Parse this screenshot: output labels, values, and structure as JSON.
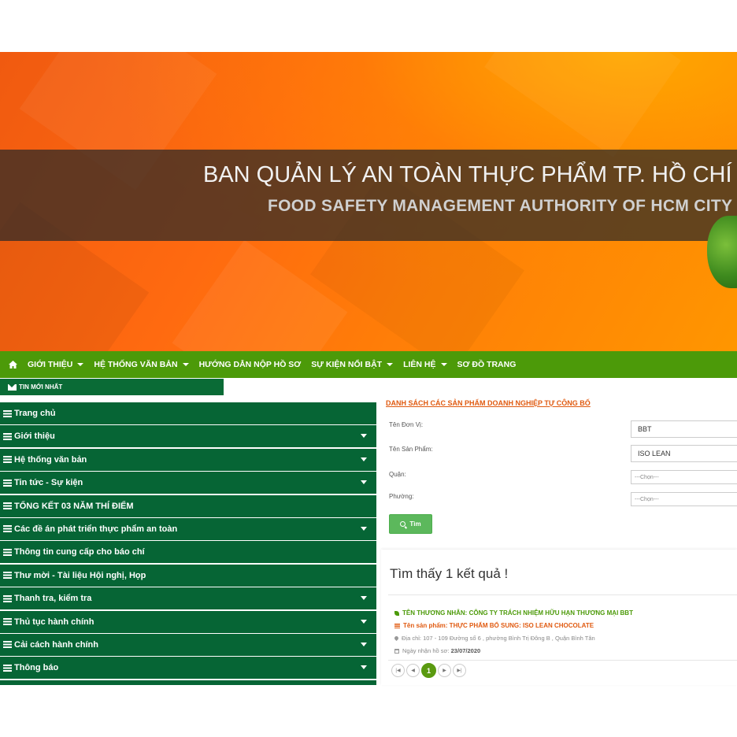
{
  "banner": {
    "title_vi": "BAN QUẢN LÝ AN TOÀN THỰC PHẨM TP. HỒ CHÍ MINH",
    "title_en": "FOOD SAFETY MANAGEMENT AUTHORITY OF HCM CITY"
  },
  "nav": {
    "home_icon": "home-icon",
    "items": [
      {
        "label": "GIỚI THIỆU",
        "dropdown": true
      },
      {
        "label": "HỆ THỐNG VĂN BẢN",
        "dropdown": true
      },
      {
        "label": "HƯỚNG DẪN NỘP HỒ SƠ",
        "dropdown": false
      },
      {
        "label": "SỰ KIỆN NỔI BẬT",
        "dropdown": true
      },
      {
        "label": "LIÊN HỆ",
        "dropdown": true
      },
      {
        "label": "SƠ ĐỒ TRANG",
        "dropdown": false
      }
    ]
  },
  "news_bar": {
    "label": "TIN MỚI NHẤT",
    "icon": "envelope-icon"
  },
  "sidebar": {
    "items": [
      {
        "label": "Trang chủ",
        "dropdown": false
      },
      {
        "label": "Giới thiệu",
        "dropdown": true
      },
      {
        "label": "Hệ thống văn bản",
        "dropdown": true
      },
      {
        "label": "Tin tức - Sự kiện",
        "dropdown": true
      },
      {
        "label": "TỔNG KẾT 03 NĂM THÍ ĐIỂM",
        "dropdown": false
      },
      {
        "label": "Các đề án phát triển thực phẩm an toàn",
        "dropdown": true
      },
      {
        "label": "Thông tin cung cấp cho báo chí",
        "dropdown": false
      },
      {
        "label": "Thư mời - Tài liệu Hội nghị, Họp",
        "dropdown": false
      },
      {
        "label": "Thanh tra, kiểm tra",
        "dropdown": true
      },
      {
        "label": "Thủ tục hành chính",
        "dropdown": true
      },
      {
        "label": "Cải cách hành chính",
        "dropdown": true
      },
      {
        "label": "Thông báo",
        "dropdown": true
      },
      {
        "label": "",
        "dropdown": false
      }
    ]
  },
  "search": {
    "title": "DANH SÁCH CÁC SẢN PHẨM DOANH NGHIỆP TỰ CÔNG BỐ",
    "unit_label": "Tên Đơn Vị:",
    "unit_value": "BBT",
    "product_label": "Tên Sản Phẩm:",
    "product_value": "ISO LEAN",
    "district_label": "Quận:",
    "district_value": "---Chọn---",
    "ward_label": "Phường:",
    "ward_value": "---Chọn---",
    "button_label": "Tìm"
  },
  "results": {
    "count_text": "Tìm thấy 1 kết quả !",
    "items": [
      {
        "merchant": "TÊN THƯƠNG NHÂN: CÔNG TY TRÁCH NHIỆM HỮU HẠN THƯƠNG MẠI BBT",
        "product": "Tên sản phẩm: THỰC PHẨM BỔ SUNG: ISO LEAN CHOCOLATE",
        "address": "Địa chỉ: 107 - 109 Đường số 6 , phường Bình Trị Đông B , Quận Bình Tân",
        "date_label": "Ngày nhận hồ sơ:",
        "date_value": "23/07/2020"
      }
    ]
  },
  "pagination": {
    "first": "|◀",
    "prev": "◀",
    "current": "1",
    "next": "▶",
    "last": "▶|"
  }
}
